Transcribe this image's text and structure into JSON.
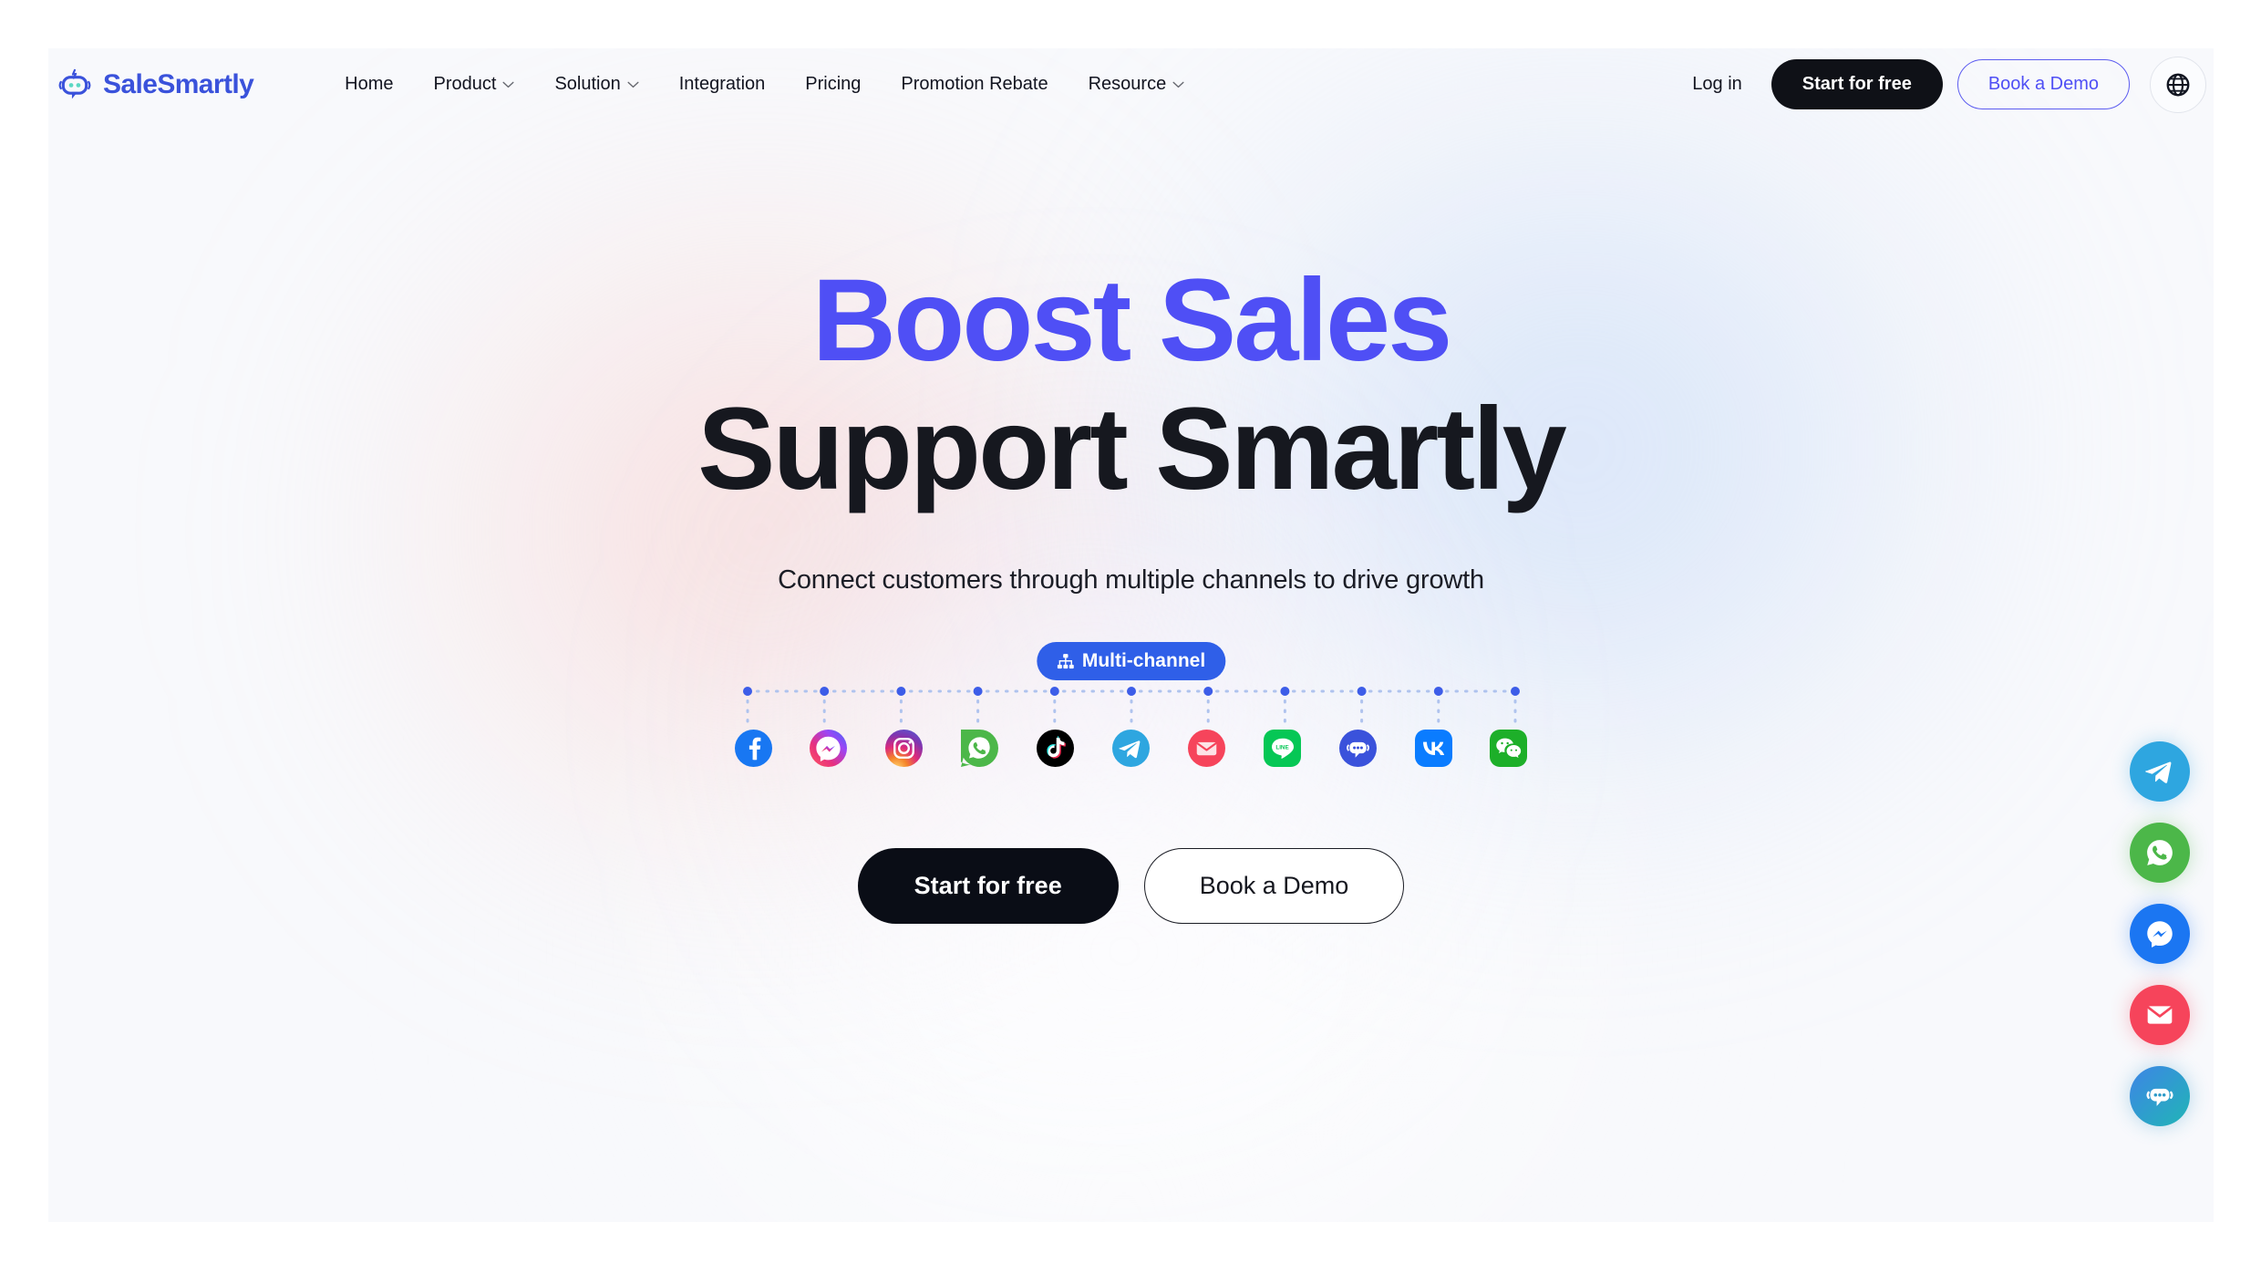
{
  "brand": {
    "name": "SaleSmartly",
    "logo_icon": "robot-chat-icon",
    "color": "#3A52DB"
  },
  "nav": {
    "items": [
      {
        "label": "Home",
        "has_dropdown": false
      },
      {
        "label": "Product",
        "has_dropdown": true
      },
      {
        "label": "Solution",
        "has_dropdown": true
      },
      {
        "label": "Integration",
        "has_dropdown": false
      },
      {
        "label": "Pricing",
        "has_dropdown": false
      },
      {
        "label": "Promotion Rebate",
        "has_dropdown": false
      },
      {
        "label": "Resource",
        "has_dropdown": true
      }
    ]
  },
  "header_actions": {
    "login_label": "Log in",
    "start_free_label": "Start for free",
    "book_demo_label": "Book a Demo",
    "language_icon": "globe-icon",
    "start_free_bg": "#0F1117",
    "book_demo_color": "#4F4FF5"
  },
  "hero": {
    "headline_line1": "Boost Sales",
    "headline_line2": "Support Smartly",
    "headline_line1_color": "#4F4FF5",
    "headline_line2_color": "#16181F",
    "subheadline": "Connect customers through multiple channels to drive growth",
    "badge": {
      "label": "Multi-channel",
      "icon": "sitemap-icon",
      "bg": "#2F5FE8"
    },
    "cta_primary": "Start for free",
    "cta_secondary": "Book a Demo"
  },
  "channels": [
    {
      "name": "Facebook",
      "icon": "facebook-icon",
      "color": "#1877F2"
    },
    {
      "name": "Messenger",
      "icon": "messenger-icon",
      "color": "#A334FA"
    },
    {
      "name": "Instagram",
      "icon": "instagram-icon",
      "color": "#E1306C"
    },
    {
      "name": "WhatsApp",
      "icon": "whatsapp-icon",
      "color": "#4CB749"
    },
    {
      "name": "TikTok",
      "icon": "tiktok-icon",
      "color": "#000000"
    },
    {
      "name": "Telegram",
      "icon": "telegram-icon",
      "color": "#2EA6E0"
    },
    {
      "name": "Email",
      "icon": "email-icon",
      "color": "#F6445B"
    },
    {
      "name": "LINE",
      "icon": "line-icon",
      "color": "#06C755"
    },
    {
      "name": "SaleSmartly Chat",
      "icon": "chat-bot-icon",
      "color": "#3A52DB"
    },
    {
      "name": "VK",
      "icon": "vk-icon",
      "color": "#0A7CFF"
    },
    {
      "name": "WeChat",
      "icon": "wechat-icon",
      "color": "#1DAF29"
    }
  ],
  "floating_rail": [
    {
      "name": "Telegram",
      "icon": "telegram-icon",
      "color": "#2EA6E0"
    },
    {
      "name": "WhatsApp",
      "icon": "whatsapp-icon",
      "color": "#4CB749"
    },
    {
      "name": "Messenger",
      "icon": "messenger-icon",
      "color": "#1B76F2"
    },
    {
      "name": "Email",
      "icon": "email-icon",
      "color": "#F6445B"
    },
    {
      "name": "Live Chat",
      "icon": "chat-bot-icon",
      "color": "#3D85E6"
    }
  ]
}
